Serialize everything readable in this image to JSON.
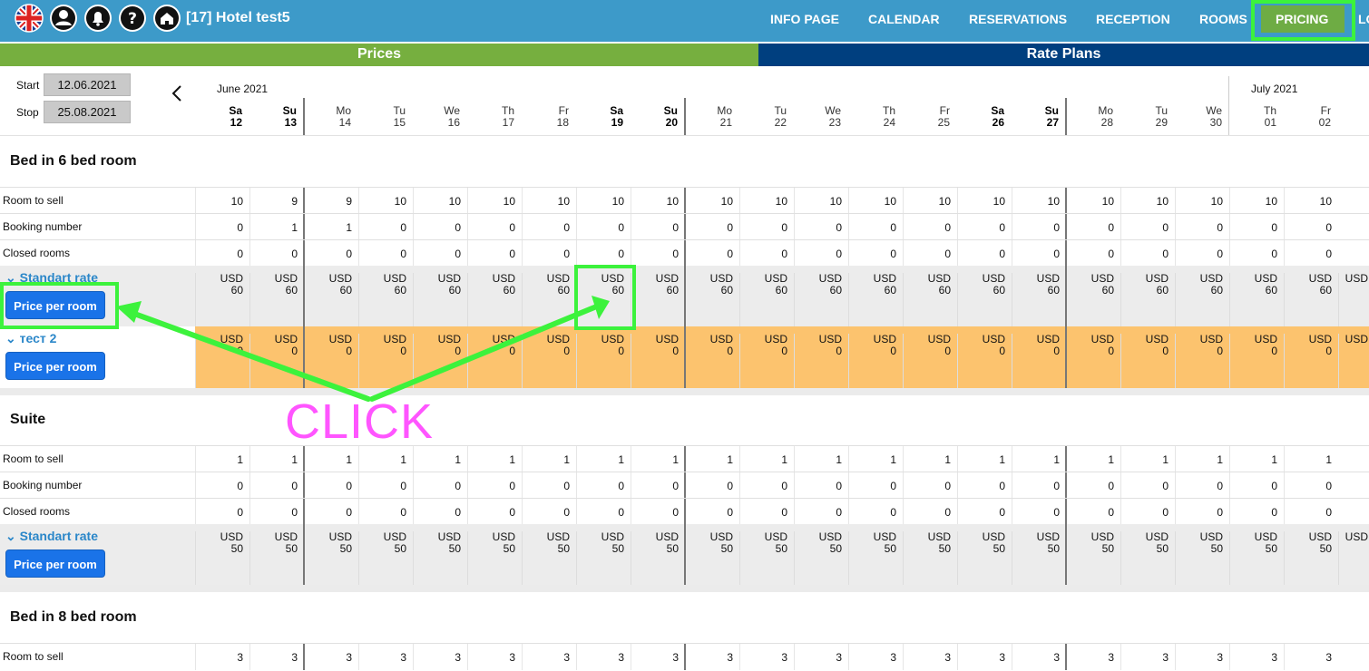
{
  "topbar": {
    "hotel_title": "[17] Hotel test5",
    "icons": [
      "uk-flag-icon",
      "user-icon",
      "bell-icon",
      "help-icon",
      "home-icon"
    ],
    "nav": [
      "INFO PAGE",
      "CALENDAR",
      "RESERVATIONS",
      "RECEPTION",
      "ROOMS",
      "PRICING",
      "LO"
    ],
    "active_nav": "PRICING"
  },
  "tabs": {
    "prices": "Prices",
    "rate_plans": "Rate Plans"
  },
  "date_range": {
    "start_label": "Start",
    "start_value": "12.06.2021",
    "stop_label": "Stop",
    "stop_value": "25.08.2021"
  },
  "months": {
    "june": "June 2021",
    "july": "July 2021"
  },
  "days": [
    {
      "dow": "Sa",
      "d": "12"
    },
    {
      "dow": "Su",
      "d": "13"
    },
    {
      "dow": "Mo",
      "d": "14"
    },
    {
      "dow": "Tu",
      "d": "15"
    },
    {
      "dow": "We",
      "d": "16"
    },
    {
      "dow": "Th",
      "d": "17"
    },
    {
      "dow": "Fr",
      "d": "18"
    },
    {
      "dow": "Sa",
      "d": "19"
    },
    {
      "dow": "Su",
      "d": "20"
    },
    {
      "dow": "Mo",
      "d": "21"
    },
    {
      "dow": "Tu",
      "d": "22"
    },
    {
      "dow": "We",
      "d": "23"
    },
    {
      "dow": "Th",
      "d": "24"
    },
    {
      "dow": "Fr",
      "d": "25"
    },
    {
      "dow": "Sa",
      "d": "26"
    },
    {
      "dow": "Su",
      "d": "27"
    },
    {
      "dow": "Mo",
      "d": "28"
    },
    {
      "dow": "Tu",
      "d": "29"
    },
    {
      "dow": "We",
      "d": "30"
    },
    {
      "dow": "Th",
      "d": "01"
    },
    {
      "dow": "Fr",
      "d": "02"
    }
  ],
  "row_labels": {
    "sell": "Room to sell",
    "booking": "Booking number",
    "closed": "Closed rooms"
  },
  "price_button_label": "Price per room",
  "currency": "USD",
  "room_types": [
    {
      "name": "Bed in 6 bed room",
      "room_to_sell": [
        10,
        9,
        9,
        10,
        10,
        10,
        10,
        10,
        10,
        10,
        10,
        10,
        10,
        10,
        10,
        10,
        10,
        10,
        10,
        10,
        10
      ],
      "booking_number": [
        0,
        1,
        1,
        0,
        0,
        0,
        0,
        0,
        0,
        0,
        0,
        0,
        0,
        0,
        0,
        0,
        0,
        0,
        0,
        0,
        0
      ],
      "closed_rooms": [
        0,
        0,
        0,
        0,
        0,
        0,
        0,
        0,
        0,
        0,
        0,
        0,
        0,
        0,
        0,
        0,
        0,
        0,
        0,
        0,
        0
      ],
      "rates": [
        {
          "name": "Standart rate",
          "price": 60,
          "style": "grey"
        },
        {
          "name": "тест 2",
          "price": 0,
          "style": "orange"
        }
      ]
    },
    {
      "name": "Suite",
      "room_to_sell": [
        1,
        1,
        1,
        1,
        1,
        1,
        1,
        1,
        1,
        1,
        1,
        1,
        1,
        1,
        1,
        1,
        1,
        1,
        1,
        1,
        1
      ],
      "booking_number": [
        0,
        0,
        0,
        0,
        0,
        0,
        0,
        0,
        0,
        0,
        0,
        0,
        0,
        0,
        0,
        0,
        0,
        0,
        0,
        0,
        0
      ],
      "closed_rooms": [
        0,
        0,
        0,
        0,
        0,
        0,
        0,
        0,
        0,
        0,
        0,
        0,
        0,
        0,
        0,
        0,
        0,
        0,
        0,
        0,
        0
      ],
      "rates": [
        {
          "name": "Standart rate",
          "price": 50,
          "style": "grey"
        }
      ]
    },
    {
      "name": "Bed in 8 bed room",
      "room_to_sell": [
        3,
        3,
        3,
        3,
        3,
        3,
        3,
        3,
        3,
        3,
        3,
        3,
        3,
        3,
        3,
        3,
        3,
        3,
        3,
        3,
        3
      ]
    }
  ],
  "annotation": {
    "text": "CLICK",
    "color": "#ff55ff",
    "highlight_color": "#3cf23c"
  },
  "colors": {
    "topbar": "#3d9ac9",
    "prices_tab": "#76af3f",
    "rate_plans_tab": "#003f7f",
    "orange_rate": "#fcc36e",
    "button": "#1a73e8",
    "rate_link": "#2b87c9"
  }
}
